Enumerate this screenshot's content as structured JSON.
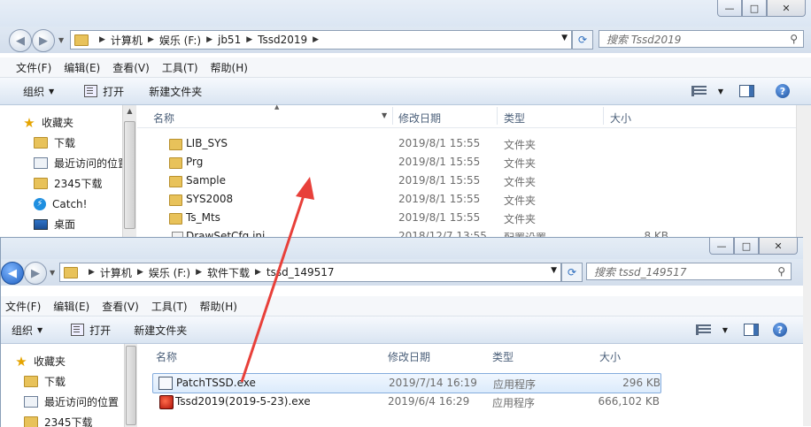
{
  "window1": {
    "caption_buttons": {
      "minimize": "—",
      "maximize": "□",
      "close": "✕"
    },
    "breadcrumb": [
      "计算机",
      "娱乐 (F:)",
      "jb51",
      "Tssd2019"
    ],
    "search_placeholder": "搜索 Tssd2019",
    "menu": [
      "文件(F)",
      "编辑(E)",
      "查看(V)",
      "工具(T)",
      "帮助(H)"
    ],
    "toolbar": {
      "organize": "组织",
      "open": "打开",
      "new_folder": "新建文件夹"
    },
    "nav": [
      {
        "label": "收藏夹",
        "icon": "star-icon",
        "level": 1
      },
      {
        "label": "下载",
        "icon": "folder-icon",
        "level": 2
      },
      {
        "label": "最近访问的位置",
        "icon": "recent-places-icon",
        "level": 2
      },
      {
        "label": "2345下载",
        "icon": "folder-icon",
        "level": 2
      },
      {
        "label": "Catch!",
        "icon": "catch-icon",
        "level": 2
      },
      {
        "label": "桌面",
        "icon": "desktop-icon",
        "level": 2
      }
    ],
    "columns": {
      "name": "名称",
      "date": "修改日期",
      "type": "类型",
      "size": "大小"
    },
    "files": [
      {
        "name": "LIB_SYS",
        "date": "2019/8/1 15:55",
        "type": "文件夹",
        "size": ""
      },
      {
        "name": "Prg",
        "date": "2019/8/1 15:55",
        "type": "文件夹",
        "size": ""
      },
      {
        "name": "Sample",
        "date": "2019/8/1 15:55",
        "type": "文件夹",
        "size": ""
      },
      {
        "name": "SYS2008",
        "date": "2019/8/1 15:55",
        "type": "文件夹",
        "size": ""
      },
      {
        "name": "Ts_Mts",
        "date": "2019/8/1 15:55",
        "type": "文件夹",
        "size": ""
      },
      {
        "name": "DrawSetCfg.ini",
        "date": "2018/12/7 13:55",
        "type": "配置设置",
        "size": "8 KB"
      }
    ]
  },
  "window2": {
    "caption_buttons": {
      "minimize": "—",
      "maximize": "□",
      "close": "✕"
    },
    "breadcrumb": [
      "计算机",
      "娱乐 (F:)",
      "软件下载",
      "tssd_149517"
    ],
    "search_placeholder": "搜索 tssd_149517",
    "menu": [
      "文件(F)",
      "编辑(E)",
      "查看(V)",
      "工具(T)",
      "帮助(H)"
    ],
    "toolbar": {
      "organize": "组织",
      "open": "打开",
      "new_folder": "新建文件夹"
    },
    "nav": [
      {
        "label": "收藏夹",
        "icon": "star-icon",
        "level": 1
      },
      {
        "label": "下载",
        "icon": "folder-icon",
        "level": 2
      },
      {
        "label": "最近访问的位置",
        "icon": "recent-places-icon",
        "level": 2
      },
      {
        "label": "2345下载",
        "icon": "folder-icon",
        "level": 2
      }
    ],
    "columns": {
      "name": "名称",
      "date": "修改日期",
      "type": "类型",
      "size": "大小"
    },
    "files": [
      {
        "name": "PatchTSSD.exe",
        "date": "2019/7/14 16:19",
        "type": "应用程序",
        "size": "296 KB",
        "selected": true
      },
      {
        "name": "Tssd2019(2019-5-23).exe",
        "date": "2019/6/4 16:29",
        "type": "应用程序",
        "size": "666,102 KB",
        "selected": false
      }
    ]
  },
  "arrow_color": "#e8403a"
}
